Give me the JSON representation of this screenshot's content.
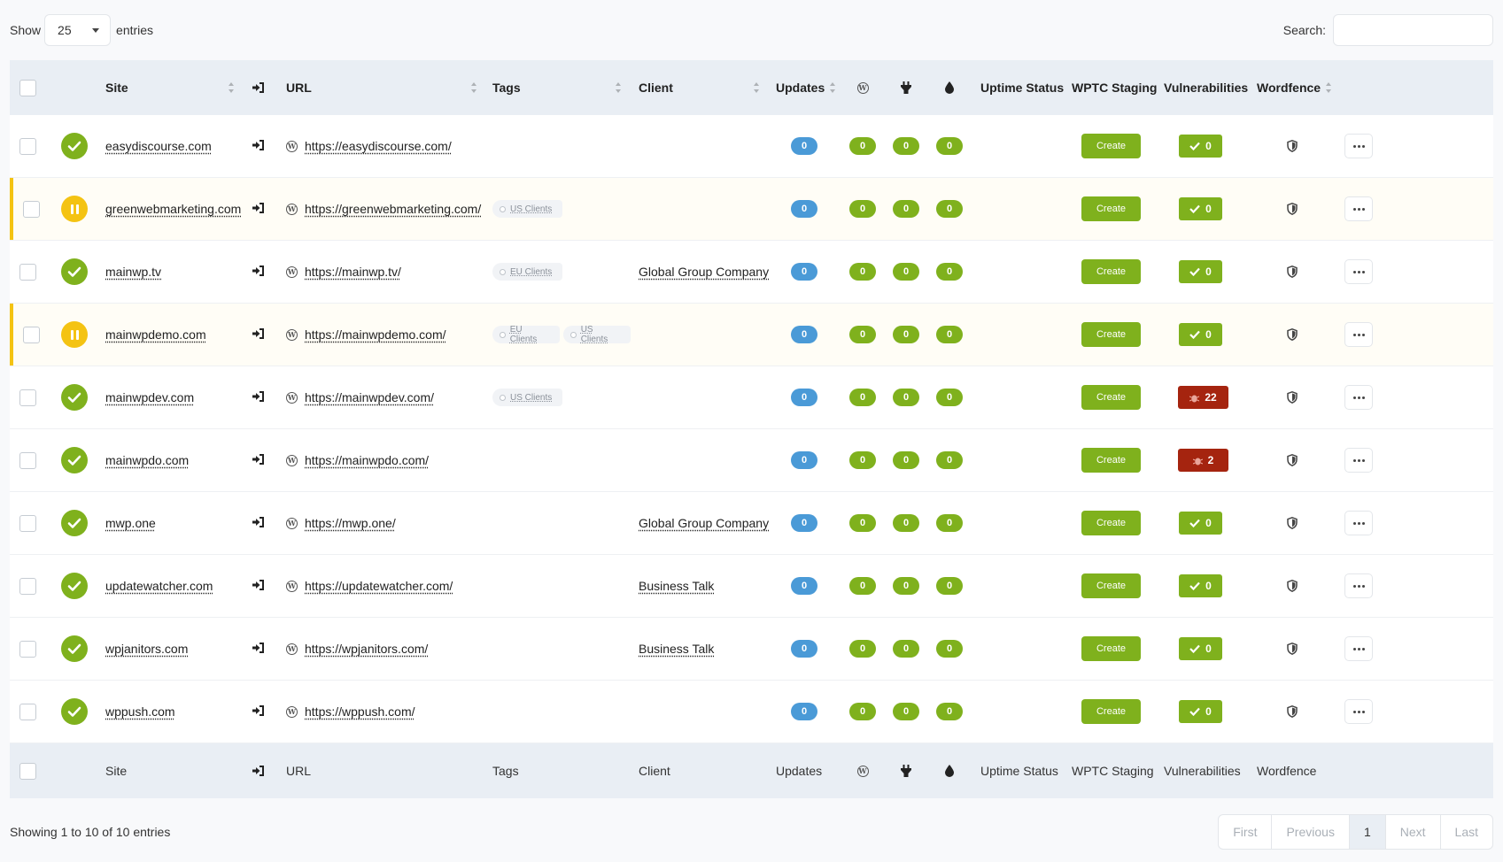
{
  "length_menu": {
    "show_label": "Show",
    "value": "25",
    "entries_label": "entries"
  },
  "search": {
    "label": "Search:",
    "value": "",
    "placeholder": ""
  },
  "columns": {
    "site": "Site",
    "url": "URL",
    "tags": "Tags",
    "client": "Client",
    "updates": "Updates",
    "uptime": "Uptime Status",
    "staging": "WPTC Staging",
    "vulnerabilities": "Vulnerabilities",
    "wordfence": "Wordfence"
  },
  "icons": {
    "login": "sign-in-icon",
    "wordpress": "wordpress-icon",
    "plugin": "plug-icon",
    "theme": "tint-icon",
    "status_ok": "check-circle-icon",
    "status_paused": "pause-circle-icon",
    "wordfence": "shield-icon",
    "more": "ellipsis-icon"
  },
  "colors": {
    "ok": "#7fb11d",
    "paused": "#f4c313",
    "updates": "#4a9ad7",
    "vulnerable": "#a5240f"
  },
  "rows": [
    {
      "status": "ok",
      "site": "easydiscourse.com",
      "url": "https://easydiscourse.com/",
      "tags": [],
      "client": "",
      "updates": "0",
      "wp": "0",
      "plugins": "0",
      "themes": "0",
      "staging": "Create",
      "vuln": "0",
      "vuln_state": "ok"
    },
    {
      "status": "paused",
      "site": "greenwebmarketing.com",
      "url": "https://greenwebmarketing.com/",
      "tags": [
        "US Clients"
      ],
      "client": "",
      "updates": "0",
      "wp": "0",
      "plugins": "0",
      "themes": "0",
      "staging": "Create",
      "vuln": "0",
      "vuln_state": "ok"
    },
    {
      "status": "ok",
      "site": "mainwp.tv",
      "url": "https://mainwp.tv/",
      "tags": [
        "EU Clients"
      ],
      "client": "Global Group Company",
      "updates": "0",
      "wp": "0",
      "plugins": "0",
      "themes": "0",
      "staging": "Create",
      "vuln": "0",
      "vuln_state": "ok"
    },
    {
      "status": "paused",
      "site": "mainwpdemo.com",
      "url": "https://mainwpdemo.com/",
      "tags": [
        "EU Clients",
        "US Clients"
      ],
      "client": "",
      "updates": "0",
      "wp": "0",
      "plugins": "0",
      "themes": "0",
      "staging": "Create",
      "vuln": "0",
      "vuln_state": "ok"
    },
    {
      "status": "ok",
      "site": "mainwpdev.com",
      "url": "https://mainwpdev.com/",
      "tags": [
        "US Clients"
      ],
      "client": "",
      "updates": "0",
      "wp": "0",
      "plugins": "0",
      "themes": "0",
      "staging": "Create",
      "vuln": "22",
      "vuln_state": "bad"
    },
    {
      "status": "ok",
      "site": "mainwpdo.com",
      "url": "https://mainwpdo.com/",
      "tags": [],
      "client": "",
      "updates": "0",
      "wp": "0",
      "plugins": "0",
      "themes": "0",
      "staging": "Create",
      "vuln": "2",
      "vuln_state": "bad"
    },
    {
      "status": "ok",
      "site": "mwp.one",
      "url": "https://mwp.one/",
      "tags": [],
      "client": "Global Group Company",
      "updates": "0",
      "wp": "0",
      "plugins": "0",
      "themes": "0",
      "staging": "Create",
      "vuln": "0",
      "vuln_state": "ok"
    },
    {
      "status": "ok",
      "site": "updatewatcher.com",
      "url": "https://updatewatcher.com/",
      "tags": [],
      "client": "Business Talk",
      "updates": "0",
      "wp": "0",
      "plugins": "0",
      "themes": "0",
      "staging": "Create",
      "vuln": "0",
      "vuln_state": "ok"
    },
    {
      "status": "ok",
      "site": "wpjanitors.com",
      "url": "https://wpjanitors.com/",
      "tags": [],
      "client": "Business Talk",
      "updates": "0",
      "wp": "0",
      "plugins": "0",
      "themes": "0",
      "staging": "Create",
      "vuln": "0",
      "vuln_state": "ok"
    },
    {
      "status": "ok",
      "site": "wppush.com",
      "url": "https://wppush.com/",
      "tags": [],
      "client": "",
      "updates": "0",
      "wp": "0",
      "plugins": "0",
      "themes": "0",
      "staging": "Create",
      "vuln": "0",
      "vuln_state": "ok"
    }
  ],
  "info": "Showing 1 to 10 of 10 entries",
  "pagination": {
    "first": "First",
    "previous": "Previous",
    "current": "1",
    "next": "Next",
    "last": "Last"
  }
}
